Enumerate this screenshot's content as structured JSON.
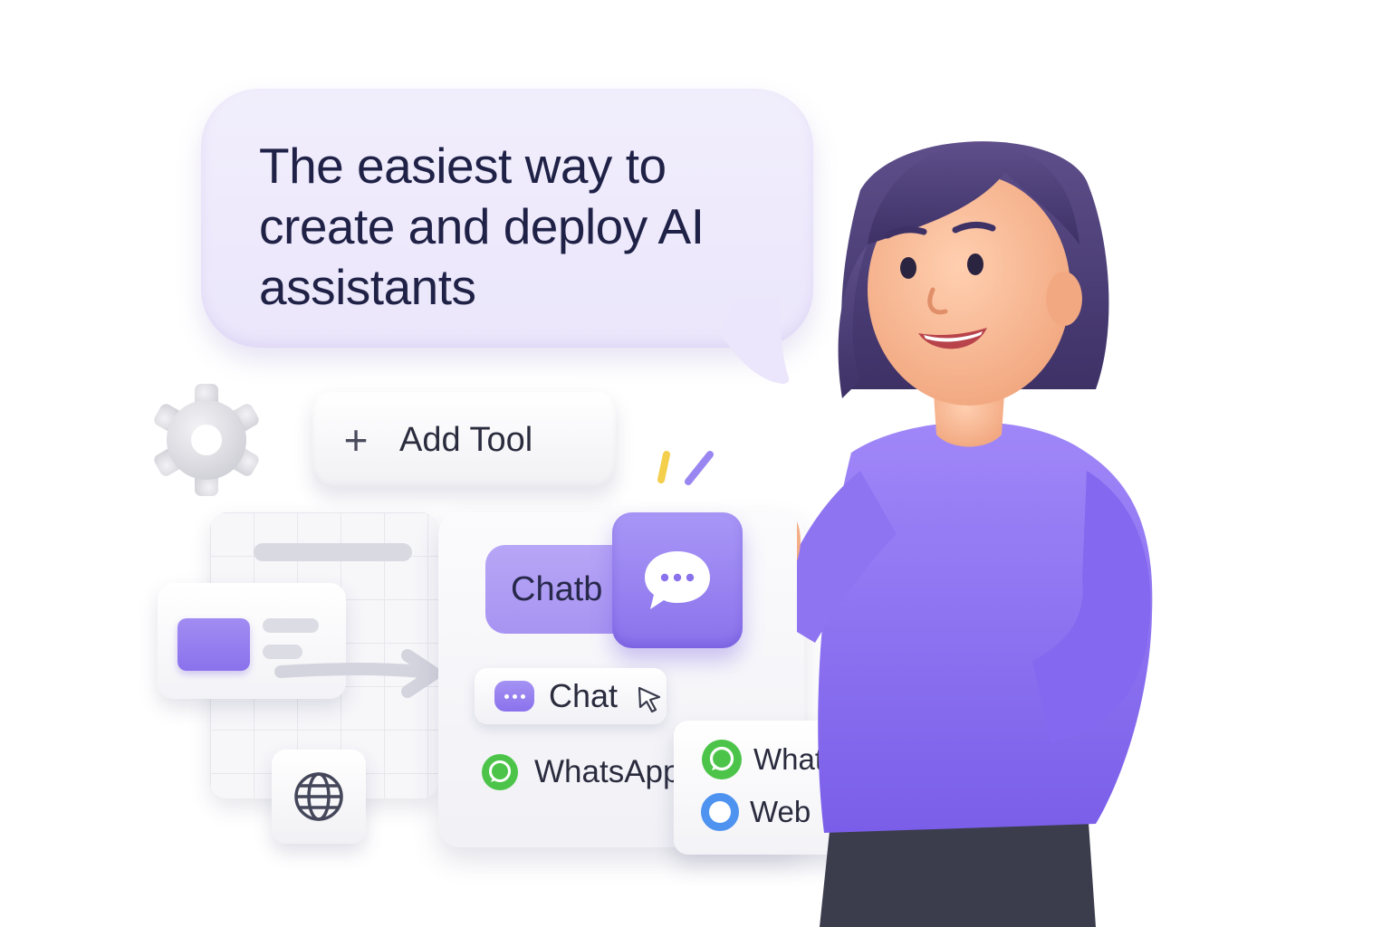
{
  "hero": {
    "headline": "The easiest way to create and deploy AI assistants"
  },
  "toolbar": {
    "add_tool_label": "Add Tool"
  },
  "builder": {
    "chatbot_label": "Chatb",
    "chat_label": "Chat",
    "whatsapp_label": "WhatsApp"
  },
  "channels": {
    "items": [
      {
        "label": "WhatsApp",
        "icon": "whatsapp-icon"
      },
      {
        "label": "Web",
        "icon": "web-ring-icon"
      }
    ]
  },
  "colors": {
    "accent": "#8a72ec",
    "bubble": "#ece8fb",
    "whatsapp": "#4cc44a",
    "web": "#4d93ef",
    "text": "#1f2146"
  }
}
